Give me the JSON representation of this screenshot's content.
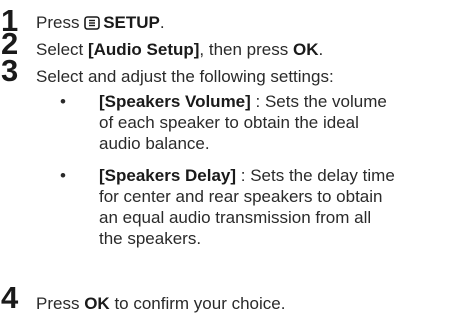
{
  "steps": [
    {
      "number": "1",
      "prefix": "Press",
      "icon": "disc-menu-icon",
      "button": "SETUP",
      "suffix": "."
    },
    {
      "number": "2",
      "prefix": "Select",
      "item": "[Audio Setup]",
      "middle": ", then press",
      "button": "OK",
      "suffix": "."
    },
    {
      "number": "3",
      "text": "Select and adjust the following settings:"
    },
    {
      "number": "4",
      "prefix": "Press",
      "button": "OK",
      "suffix": "to confirm your choice."
    }
  ],
  "bullets": [
    {
      "marker": "•",
      "term": "[Speakers Volume]",
      "lines": [
        " : Sets the volume",
        "of each speaker to obtain the ideal",
        "audio balance."
      ]
    },
    {
      "marker": "•",
      "term": "[Speakers Delay]",
      "lines": [
        " : Sets the delay time",
        "for center and rear speakers to obtain",
        "an equal audio transmission from all",
        "the speakers."
      ]
    }
  ]
}
